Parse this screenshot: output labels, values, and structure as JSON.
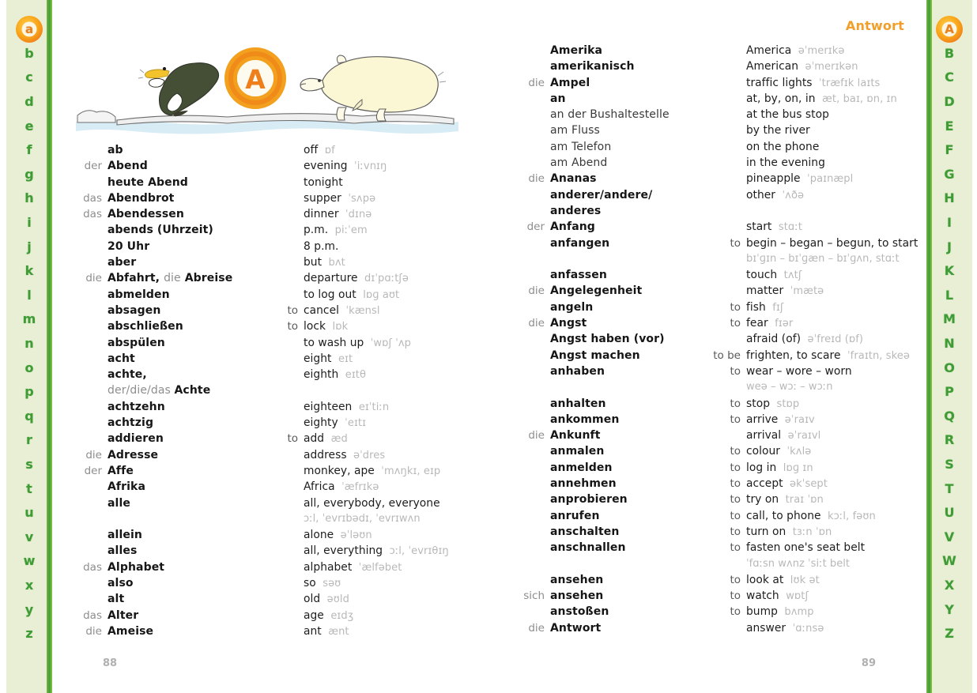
{
  "book": {
    "running_head": "Antwort",
    "page_left": "88",
    "page_right": "89",
    "accent_orange": "#ef7f1a",
    "accent_green": "#3f9c35",
    "tab_bg": "#e8efd4",
    "ipa_gray": "#b8b8b8"
  },
  "illustration": {
    "name": "penguin-jumping-through-letter-a-ring-toward-polar-bear-on-ice",
    "letter": "A",
    "elements": [
      "penguin",
      "orange-letter-a-ring",
      "polar-bear",
      "ice-floe",
      "water"
    ]
  },
  "side_tabs": {
    "left": {
      "active": "a",
      "letters": [
        "a",
        "b",
        "c",
        "d",
        "e",
        "f",
        "g",
        "h",
        "i",
        "j",
        "k",
        "l",
        "m",
        "n",
        "o",
        "p",
        "q",
        "r",
        "s",
        "t",
        "u",
        "v",
        "w",
        "x",
        "y",
        "z"
      ]
    },
    "right": {
      "active": "A",
      "letters": [
        "A",
        "B",
        "C",
        "D",
        "E",
        "F",
        "G",
        "H",
        "I",
        "J",
        "K",
        "L",
        "M",
        "N",
        "O",
        "P",
        "Q",
        "R",
        "S",
        "T",
        "U",
        "V",
        "W",
        "X",
        "Y",
        "Z"
      ]
    }
  },
  "left_page": {
    "entries": [
      {
        "art": "",
        "de": "ab",
        "to": "",
        "en": "off",
        "ipa": "ɒf"
      },
      {
        "art": "der",
        "de": "Abend",
        "to": "",
        "en": "evening",
        "ipa": "ˈiːvnɪŋ"
      },
      {
        "art": "",
        "de": "heute Abend",
        "to": "",
        "en": "tonight",
        "ipa": ""
      },
      {
        "art": "das",
        "de": "Abendbrot",
        "to": "",
        "en": "supper",
        "ipa": "ˈsʌpə"
      },
      {
        "art": "das",
        "de": "Abendessen",
        "to": "",
        "en": "dinner",
        "ipa": "ˈdɪnə"
      },
      {
        "art": "",
        "de": "abends (Uhrzeit)",
        "to": "",
        "en": "p.m.",
        "ipa": "piːˈem"
      },
      {
        "art": "",
        "de": "20 Uhr",
        "to": "",
        "en": "8 p.m.",
        "ipa": ""
      },
      {
        "art": "",
        "de": "aber",
        "to": "",
        "en": "but",
        "ipa": "bʌt"
      },
      {
        "art": "die",
        "de": "Abfahrt, die Abreise",
        "de_mixed": true,
        "to": "",
        "en": "departure",
        "ipa": "dɪˈpɑːtʃə"
      },
      {
        "art": "",
        "de": "abmelden",
        "to": "",
        "en": "to log out",
        "ipa": "lɒɡ aʊt"
      },
      {
        "art": "",
        "de": "absagen",
        "to": "to",
        "en": "cancel",
        "ipa": "ˈkænsl"
      },
      {
        "art": "",
        "de": "abschließen",
        "to": "to",
        "en": "lock",
        "ipa": "lɒk"
      },
      {
        "art": "",
        "de": "abspülen",
        "to": "",
        "en": "to wash up",
        "ipa": "ˈwɒʃ ˈʌp"
      },
      {
        "art": "",
        "de": "acht",
        "to": "",
        "en": "eight",
        "ipa": "eɪt"
      },
      {
        "art": "",
        "de": "achte,",
        "to": "",
        "en": "eighth",
        "ipa": "eɪtθ"
      },
      {
        "art": "",
        "de": "der/die/das Achte",
        "de_prefix_gray": "der/die/das ",
        "de_bold_part": "Achte",
        "to": "",
        "en": "",
        "ipa": ""
      },
      {
        "art": "",
        "de": "achtzehn",
        "to": "",
        "en": "eighteen",
        "ipa": "eɪˈtiːn"
      },
      {
        "art": "",
        "de": "achtzig",
        "to": "",
        "en": "eighty",
        "ipa": "ˈeɪtɪ"
      },
      {
        "art": "",
        "de": "addieren",
        "to": "to",
        "en": "add",
        "ipa": "æd"
      },
      {
        "art": "die",
        "de": "Adresse",
        "to": "",
        "en": "address",
        "ipa": "əˈdres"
      },
      {
        "art": "der",
        "de": "Affe",
        "to": "",
        "en": "monkey, ape",
        "ipa": "ˈmʌŋkɪ, eɪp"
      },
      {
        "art": "",
        "de": "Afrika",
        "to": "",
        "en": "Africa",
        "ipa": "ˈæfrɪkə"
      },
      {
        "art": "",
        "de": "alle",
        "to": "",
        "en": "all, everybody, everyone",
        "ipa": ""
      },
      {
        "art": "",
        "de": "",
        "to": "",
        "en": "",
        "ipa": "ɔːl, ˈevrɪbədɪ, ˈevrɪwʌn",
        "ipa_only": true
      },
      {
        "art": "",
        "de": "allein",
        "to": "",
        "en": "alone",
        "ipa": "əˈləʊn"
      },
      {
        "art": "",
        "de": "alles",
        "to": "",
        "en": "all, everything",
        "ipa": "ɔːl, ˈevrɪθɪŋ"
      },
      {
        "art": "das",
        "de": "Alphabet",
        "to": "",
        "en": "alphabet",
        "ipa": "ˈælfəbet"
      },
      {
        "art": "",
        "de": "also",
        "to": "",
        "en": "so",
        "ipa": "səʊ"
      },
      {
        "art": "",
        "de": "alt",
        "to": "",
        "en": "old",
        "ipa": "əʊld"
      },
      {
        "art": "das",
        "de": "Alter",
        "to": "",
        "en": "age",
        "ipa": "eɪdʒ"
      },
      {
        "art": "die",
        "de": "Ameise",
        "to": "",
        "en": "ant",
        "ipa": "ænt"
      }
    ]
  },
  "right_page": {
    "entries": [
      {
        "art": "",
        "de": "Amerika",
        "to": "",
        "en": "America",
        "ipa": "əˈmerɪkə"
      },
      {
        "art": "",
        "de": "amerikanisch",
        "to": "",
        "en": "American",
        "ipa": "əˈmerɪkən"
      },
      {
        "art": "die",
        "de": "Ampel",
        "to": "",
        "en": "traffic lights",
        "ipa": "ˈtræfɪk laɪts"
      },
      {
        "art": "",
        "de": "an",
        "to": "",
        "en": "at, by, on, in",
        "ipa": "æt, baɪ, ɒn, ɪn"
      },
      {
        "art": "",
        "de": "an der Bushaltestelle",
        "plain": true,
        "to": "",
        "en": "at the bus stop",
        "ipa": ""
      },
      {
        "art": "",
        "de": "am Fluss",
        "plain": true,
        "to": "",
        "en": "by the river",
        "ipa": ""
      },
      {
        "art": "",
        "de": "am Telefon",
        "plain": true,
        "to": "",
        "en": "on the phone",
        "ipa": ""
      },
      {
        "art": "",
        "de": "am Abend",
        "plain": true,
        "to": "",
        "en": "in the evening",
        "ipa": ""
      },
      {
        "art": "die",
        "de": "Ananas",
        "to": "",
        "en": "pineapple",
        "ipa": "ˈpaɪnæpl"
      },
      {
        "art": "",
        "de": "anderer/andere/",
        "to": "",
        "en": "other",
        "ipa": "ˈʌðə"
      },
      {
        "art": "",
        "de": "anderes",
        "to": "",
        "en": "",
        "ipa": ""
      },
      {
        "art": "der",
        "de": "Anfang",
        "to": "",
        "en": "start",
        "ipa": "stɑːt"
      },
      {
        "art": "",
        "de": "anfangen",
        "to": "to",
        "en": "begin – began – begun, to start",
        "ipa": ""
      },
      {
        "art": "",
        "de": "",
        "to": "",
        "en": "",
        "ipa": "bɪˈɡɪn – bɪˈɡæn – bɪˈɡʌn, stɑːt",
        "ipa_only": true
      },
      {
        "art": "",
        "de": "anfassen",
        "to": "",
        "en": "touch",
        "ipa": "tʌtʃ"
      },
      {
        "art": "die",
        "de": "Angelegenheit",
        "to": "",
        "en": "matter",
        "ipa": "ˈmætə"
      },
      {
        "art": "",
        "de": "angeln",
        "to": "to",
        "en": "fish",
        "ipa": "fɪʃ"
      },
      {
        "art": "die",
        "de": "Angst",
        "to": "to",
        "en": "fear",
        "ipa": "fɪər"
      },
      {
        "art": "",
        "de": "Angst haben (vor)",
        "to": "",
        "en": "afraid (of)",
        "ipa": "əˈfreɪd (ɒf)"
      },
      {
        "art": "",
        "de": "Angst machen",
        "to": "to be",
        "en": "frighten, to scare",
        "ipa": "ˈfraɪtn, skeə"
      },
      {
        "art": "",
        "de": "anhaben",
        "to": "to",
        "en": "wear – wore – worn",
        "ipa": ""
      },
      {
        "art": "",
        "de": "",
        "to": "",
        "en": "",
        "ipa": "weə – wɔː – wɔːn",
        "ipa_only": true
      },
      {
        "art": "",
        "de": "anhalten",
        "to": "to",
        "en": "stop",
        "ipa": "stɒp"
      },
      {
        "art": "",
        "de": "ankommen",
        "to": "to",
        "en": "arrive",
        "ipa": "əˈraɪv"
      },
      {
        "art": "die",
        "de": "Ankunft",
        "to": "",
        "en": "arrival",
        "ipa": "əˈraɪvl"
      },
      {
        "art": "",
        "de": "anmalen",
        "to": "to",
        "en": "colour",
        "ipa": "ˈkʌlə"
      },
      {
        "art": "",
        "de": "anmelden",
        "to": "to",
        "en": "log in",
        "ipa": "lɒɡ ɪn"
      },
      {
        "art": "",
        "de": "annehmen",
        "to": "to",
        "en": "accept",
        "ipa": "əkˈsept"
      },
      {
        "art": "",
        "de": "anprobieren",
        "to": "to",
        "en": "try on",
        "ipa": "traɪ ˈɒn"
      },
      {
        "art": "",
        "de": "anrufen",
        "to": "to",
        "en": "call, to phone",
        "ipa": "kɔːl, fəʊn"
      },
      {
        "art": "",
        "de": "anschalten",
        "to": "to",
        "en": "turn on",
        "ipa": "tɜːn ˈɒn"
      },
      {
        "art": "",
        "de": "anschnallen",
        "to": "to",
        "en": "fasten one's seat belt",
        "ipa": ""
      },
      {
        "art": "",
        "de": "",
        "to": "",
        "en": "",
        "ipa": "ˈfɑːsn wʌnz ˈsiːt belt",
        "ipa_only": true
      },
      {
        "art": "",
        "de": "ansehen",
        "to": "to",
        "en": "look at",
        "ipa": "lʊk ət"
      },
      {
        "art": "sich",
        "de": "ansehen",
        "to": "to",
        "en": "watch",
        "ipa": "wɒtʃ"
      },
      {
        "art": "",
        "de": "anstoßen",
        "to": "to",
        "en": "bump",
        "ipa": "bʌmp"
      },
      {
        "art": "die",
        "de": "Antwort",
        "to": "",
        "en": "answer",
        "ipa": "ˈɑːnsə"
      }
    ]
  }
}
